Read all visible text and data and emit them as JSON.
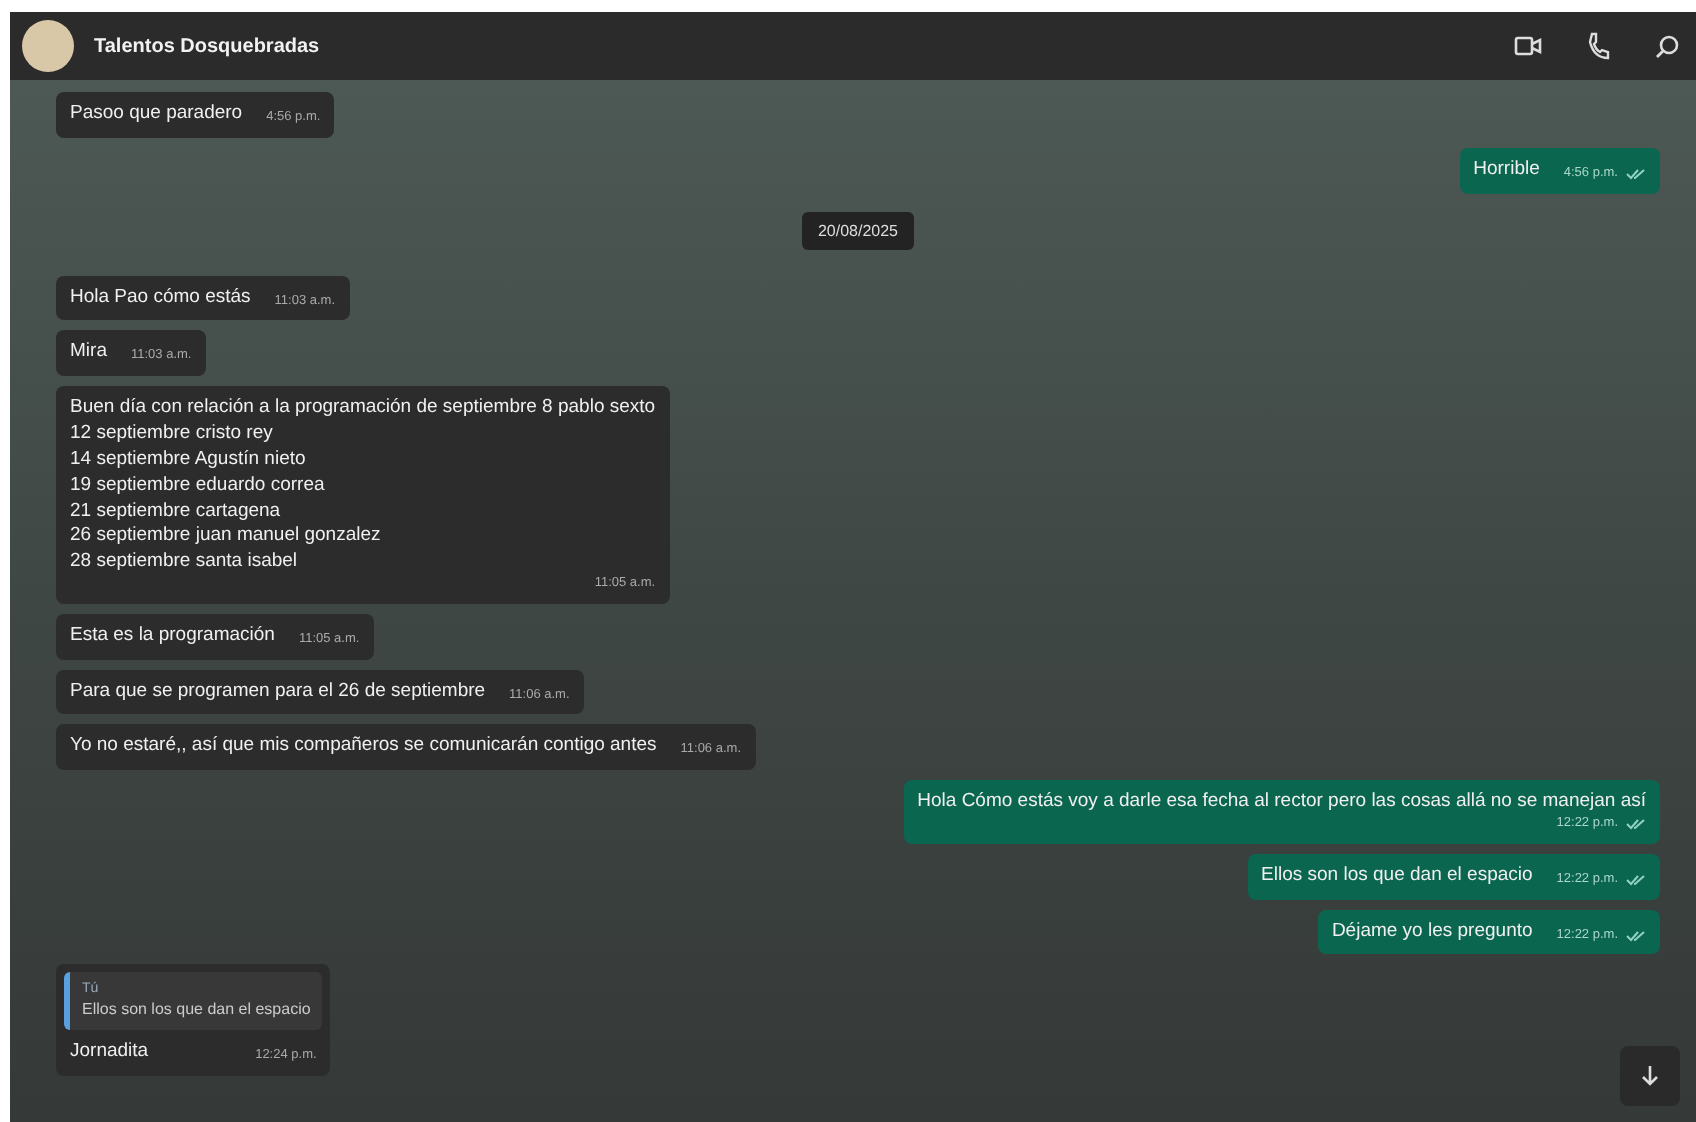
{
  "header": {
    "title": "Talentos Dosquebradas"
  },
  "messages": [
    {
      "kind": "in",
      "text": "Pasoo que paradero",
      "time": "4:56 p.m."
    },
    {
      "kind": "out",
      "text": "Horrible",
      "time": "4:56 p.m."
    },
    {
      "kind": "date",
      "text": "20/08/2025"
    },
    {
      "kind": "in",
      "text": "Hola Pao cómo estás",
      "time": "11:03 a.m."
    },
    {
      "kind": "in",
      "text": "Mira",
      "time": "11:03 a.m."
    },
    {
      "kind": "in",
      "text": "Buen día con relación a la programación  de septiembre  8 pablo sexto\n12 septiembre cristo rey\n14 septiembre Agustín nieto\n19 septiembre eduardo correa\n21 septiembre cartagena\n26 septiembre juan manuel gonzalez\n28 septiembre  santa isabel",
      "time": "11:05 a.m."
    },
    {
      "kind": "in",
      "text": "Esta es la programación",
      "time": "11:05 a.m."
    },
    {
      "kind": "in",
      "text": "Para que se programen para el 26 de septiembre",
      "time": "11:06 a.m."
    },
    {
      "kind": "in",
      "text": "Yo no estaré,, así que mis compañeros se comunicarán contigo antes",
      "time": "11:06 a.m."
    },
    {
      "kind": "out",
      "text": "Hola Cómo estás voy a darle esa fecha al rector pero las cosas allá no se manejan así",
      "time": "12:22 p.m."
    },
    {
      "kind": "out",
      "text": "Ellos son los que dan el espacio",
      "time": "12:22 p.m."
    },
    {
      "kind": "out",
      "text": "Déjame yo les pregunto",
      "time": "12:22 p.m."
    },
    {
      "kind": "reply",
      "quote_author": "Tú",
      "quote_text": "Ellos son los que dan el espacio",
      "text": "Jornadita",
      "time": "12:24 p.m."
    }
  ]
}
